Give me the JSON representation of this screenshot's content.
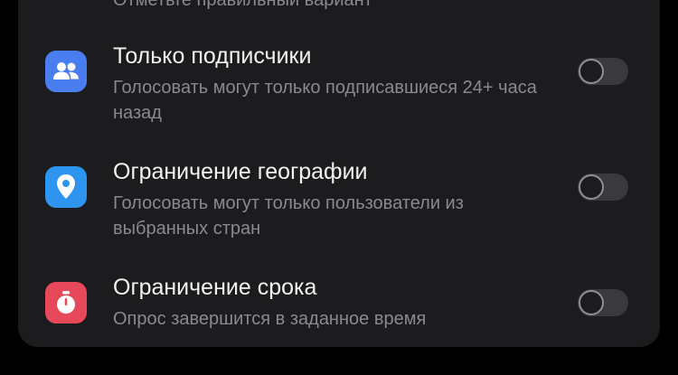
{
  "settings": {
    "items": [
      {
        "title": "",
        "description": "Отметьте правильный вариант",
        "icon": "check-icon",
        "icon_color": "#2fb84d",
        "enabled": false
      },
      {
        "title": "Только подписчики",
        "description": "Голосовать могут только подписавшиеся 24+ часа назад",
        "icon": "users-icon",
        "icon_color": "#4a7df0",
        "enabled": false
      },
      {
        "title": "Ограничение географии",
        "description": "Голосовать могут только пользователи из выбранных стран",
        "icon": "location-pin-icon",
        "icon_color": "#2d94f0",
        "enabled": false
      },
      {
        "title": "Ограничение срока",
        "description": "Опрос завершится в заданное время",
        "icon": "timer-icon",
        "icon_color": "#e8495a",
        "enabled": false
      }
    ]
  },
  "colors": {
    "background": "#000000",
    "card": "#1c1c1e",
    "title_text": "#f2f2f2",
    "secondary_text": "#8a8a8e",
    "toggle_off": "#3a3a3c"
  }
}
